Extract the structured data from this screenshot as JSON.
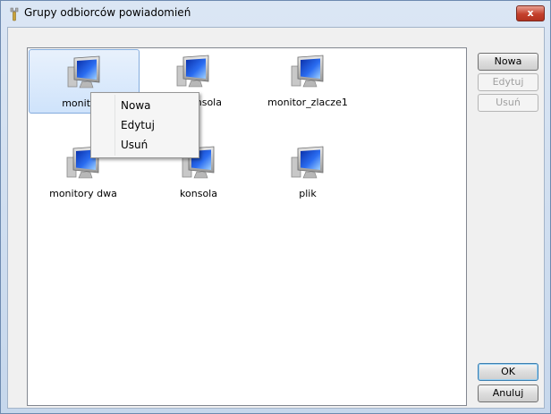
{
  "window": {
    "title": "Grupy odbiorców powiadomień",
    "close_label": "x"
  },
  "items": [
    {
      "label": "monitory"
    },
    {
      "label": "konsola"
    },
    {
      "label": "monitor_zlacze1"
    },
    {
      "label": "monitory dwa"
    },
    {
      "label": "konsola"
    },
    {
      "label": "plik"
    }
  ],
  "buttons": {
    "new": "Nowa",
    "edit": "Edytuj",
    "delete": "Usuń",
    "ok": "OK",
    "cancel": "Anuluj"
  },
  "context_menu": {
    "new": "Nowa",
    "edit": "Edytuj",
    "delete": "Usuń"
  },
  "icons": {
    "title": "tool-icon",
    "item": "computer-monitor-icon"
  },
  "colors": {
    "selection": "#cfe3fb",
    "close_button": "#c4402c",
    "monitor_screen": "#1c4fd0"
  }
}
